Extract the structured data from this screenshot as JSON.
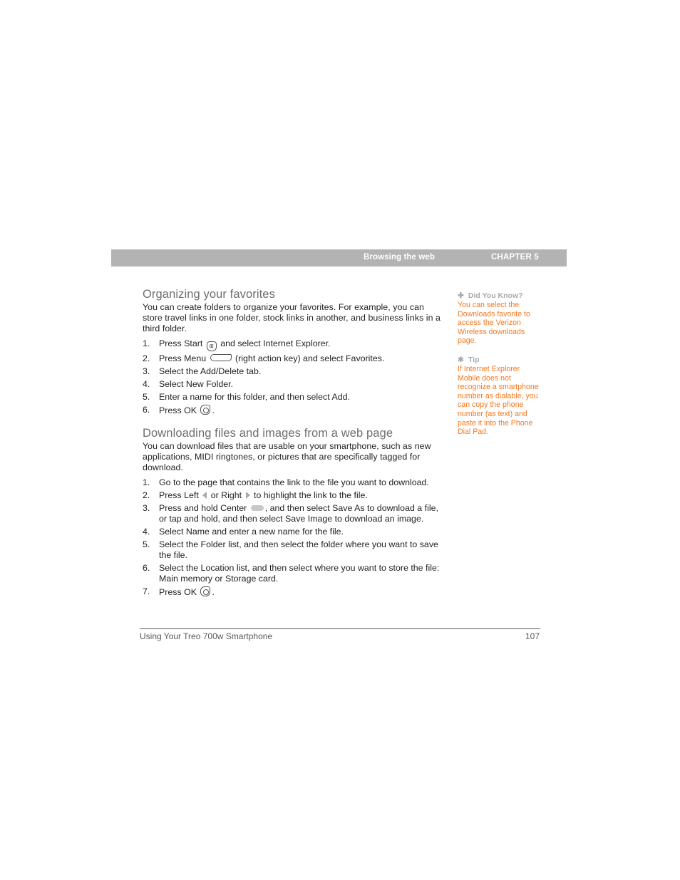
{
  "header": {
    "section": "Browsing the web",
    "chapter": "CHAPTER 5"
  },
  "sections": [
    {
      "title": "Organizing your favorites",
      "intro": "You can create folders to organize your favorites. For example, you can store travel links in one folder, stock links in another, and business links in a third folder.",
      "steps": [
        {
          "num": "1.",
          "before": "Press Start",
          "icon": "start-key-icon",
          "after": "and select Internet Explorer."
        },
        {
          "num": "2.",
          "before": "Press Menu",
          "icon": "menu-key-icon",
          "after": "(right action key) and select Favorites."
        },
        {
          "num": "3.",
          "text": "Select the Add/Delete tab."
        },
        {
          "num": "4.",
          "text": "Select New Folder."
        },
        {
          "num": "5.",
          "text": "Enter a name for this folder, and then select Add."
        },
        {
          "num": "6.",
          "before": "Press OK",
          "icon": "ok-key-icon",
          "after": "."
        }
      ]
    },
    {
      "title": "Downloading files and images from a web page",
      "intro": "You can download files that are usable on your smartphone, such as new applications, MIDI ringtones, or pictures that are specifically tagged for download.",
      "steps": [
        {
          "num": "1.",
          "text": "Go to the page that contains the link to the file you want to download."
        },
        {
          "num": "2.",
          "part1": "Press Left",
          "part2": "or Right",
          "part3": "to highlight the link to the file."
        },
        {
          "num": "3.",
          "before": "Press and hold Center",
          "icon": "center-key-icon",
          "after": ", and then select Save As to download a file, or tap and hold, and then select Save Image to download an image."
        },
        {
          "num": "4.",
          "text": "Select Name and enter a new name for the file."
        },
        {
          "num": "5.",
          "text": "Select the Folder list, and then select the folder where you want to save the file."
        },
        {
          "num": "6.",
          "text": "Select the Location list, and then select where you want to store the file: Main memory or Storage card."
        },
        {
          "num": "7.",
          "before": "Press OK",
          "icon": "ok-key-icon",
          "after": "."
        }
      ]
    }
  ],
  "sidebar": {
    "did_you_know": {
      "icon": "plus-icon",
      "symbol": "✚",
      "heading": "Did You Know?",
      "body": "You can select the Downloads favorite to access the Verizon Wireless downloads page."
    },
    "tip": {
      "icon": "asterisk-icon",
      "symbol": "✱",
      "heading": "Tip",
      "body": "If Internet Explorer Mobile does not recognize a smartphone number as dialable, you can copy the phone number (as text) and paste it into the Phone Dial Pad."
    },
    "accent_color": "#f47920"
  },
  "footer": {
    "book_title": "Using Your Treo 700w Smartphone",
    "page_number": "107"
  },
  "icon_glyphs": {
    "start": "⊞"
  }
}
